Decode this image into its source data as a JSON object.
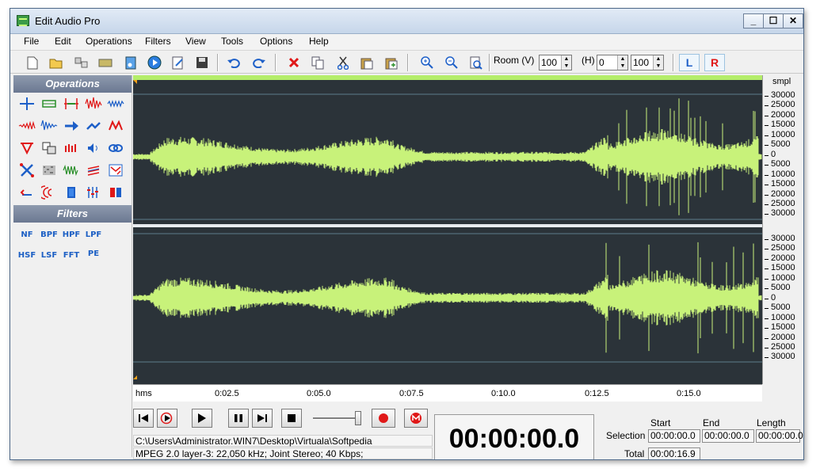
{
  "window": {
    "title": "Edit Audio Pro",
    "min_label": "_",
    "max_label": "☐",
    "close_label": "✕"
  },
  "menu": [
    "File",
    "Edit",
    "Operations",
    "Filters",
    "View",
    "Tools",
    "Options",
    "Help"
  ],
  "toolbar": {
    "room_label": "Room (V)",
    "room_v": "100",
    "h_label": "(H)",
    "h_value": "0",
    "h_zoom": "100",
    "left_channel": "L",
    "right_channel": "R"
  },
  "panel": {
    "operations_title": "Operations",
    "filters_title": "Filters",
    "filters": [
      "NF",
      "BPF",
      "HPF",
      "LPF",
      "HSF",
      "LSF",
      "FFT",
      "PE"
    ]
  },
  "scale": {
    "unit": "smpl",
    "top_ticks": [
      "30000",
      "25000",
      "20000",
      "15000",
      "10000",
      "5000",
      "0",
      "5000",
      "10000",
      "15000",
      "20000",
      "25000",
      "30000"
    ],
    "bottom_ticks": [
      "30000",
      "25000",
      "20000",
      "15000",
      "10000",
      "5000",
      "0",
      "5000",
      "10000",
      "15000",
      "20000",
      "25000",
      "30000"
    ]
  },
  "timeline": {
    "labels": [
      "hms",
      "0:02.5",
      "0:05.0",
      "0:07.5",
      "0:10.0",
      "0:12.5",
      "0:15.0"
    ]
  },
  "status": {
    "path": "C:\\Users\\Administrator.WIN7\\Desktop\\Virtuala\\Softpedia",
    "format": "MPEG 2.0 layer-3: 22,050 kHz; Joint Stereo; 40 Kbps;",
    "clock": "00:00:00.0"
  },
  "selection": {
    "start_label": "Start",
    "end_label": "End",
    "length_label": "Length",
    "selection_label": "Selection",
    "total_label": "Total",
    "start": "00:00:00.0",
    "end": "00:00:00.0",
    "length": "00:00:00.0",
    "total": "00:00:16.9"
  },
  "colors": {
    "waveform": "#c8f27a",
    "wave_bg": "#2b3339",
    "panel_head": "#7a869c",
    "accent_red": "#e02020"
  }
}
